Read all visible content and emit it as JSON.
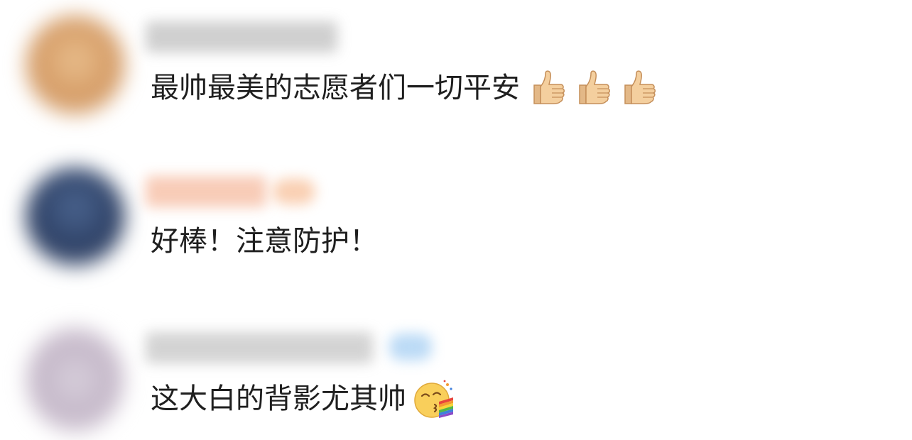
{
  "comments": [
    {
      "avatar_color": "#d9a877",
      "username_color": "#9a9a9a",
      "text": "最帅最美的志愿者们一切平安",
      "emojis": [
        "thumbs-up-icon",
        "thumbs-up-icon",
        "thumbs-up-icon"
      ]
    },
    {
      "avatar_color": "#34496e",
      "username_color": "#f2a27a",
      "text": "好棒！注意防护！",
      "emojis": []
    },
    {
      "avatar_color": "#c9bfd0",
      "username_color": "#a8a8a8",
      "text": "这大白的背影尤其帅",
      "emojis": [
        "rainbow-kiss-face-icon"
      ]
    }
  ]
}
